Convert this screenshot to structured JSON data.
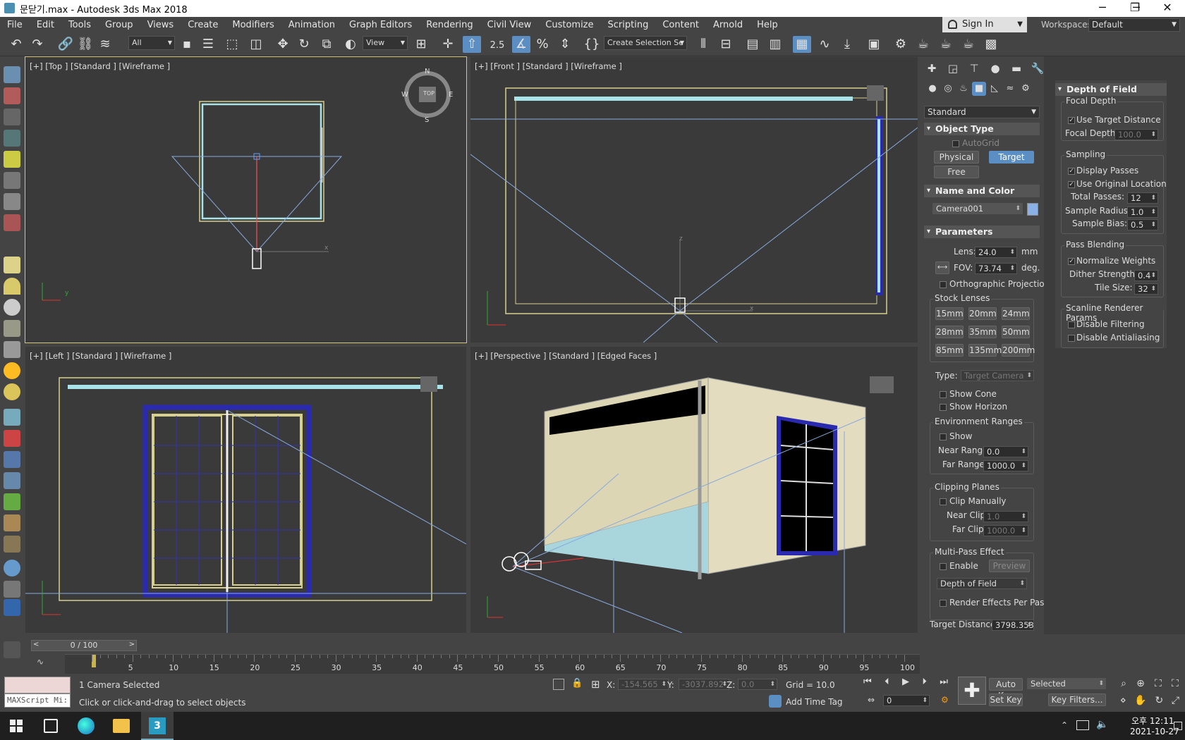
{
  "window": {
    "title": "문닫기.max - Autodesk 3ds Max 2018",
    "min": "─",
    "max": "❐",
    "close": "✕"
  },
  "menu": [
    "File",
    "Edit",
    "Tools",
    "Group",
    "Views",
    "Create",
    "Modifiers",
    "Animation",
    "Graph Editors",
    "Rendering",
    "Civil View",
    "Customize",
    "Scripting",
    "Content",
    "Arnold",
    "Help"
  ],
  "signin": {
    "label": "Sign In"
  },
  "workspaces": {
    "label": "Workspaces:",
    "value": "Default"
  },
  "toolbar": {
    "filter": "All",
    "refcoord": "View",
    "selset": "Create Selection Se",
    "snap_label": "2.5"
  },
  "viewports": {
    "top": "[+] [Top ] [Standard ] [Wireframe ]",
    "front": "[+] [Front ] [Standard ] [Wireframe ]",
    "left": "[+] [Left ] [Standard ] [Wireframe ]",
    "persp": "[+] [Perspective ] [Standard ] [Edged Faces ]",
    "viewcube_top": "TOP",
    "compass": {
      "n": "N",
      "s": "S",
      "e": "E",
      "w": "W"
    },
    "axis": {
      "x": "x",
      "y": "y",
      "z": "z"
    }
  },
  "command_panel": {
    "dropdown": "Standard",
    "object_type": {
      "title": "Object Type",
      "autogrid": "AutoGrid",
      "buttons": [
        "Physical",
        "Target",
        "Free"
      ]
    },
    "name_color": {
      "title": "Name and Color",
      "name": "Camera001",
      "color": "#8ab0e8"
    },
    "parameters": {
      "title": "Parameters",
      "lens_label": "Lens:",
      "lens": "24.0",
      "lens_unit": "mm",
      "fov_label": "FOV:",
      "fov": "73.74",
      "fov_unit": "deg.",
      "ortho": "Orthographic Projection",
      "stock_title": "Stock Lenses",
      "stock": [
        "15mm",
        "20mm",
        "24mm",
        "28mm",
        "35mm",
        "50mm",
        "85mm",
        "135mm",
        "200mm"
      ],
      "type_label": "Type:",
      "type": "Target Camera",
      "show_cone": "Show Cone",
      "show_horizon": "Show Horizon",
      "env_title": "Environment Ranges",
      "env_show": "Show",
      "near_range_label": "Near Range:",
      "near_range": "0.0",
      "far_range_label": "Far Range:",
      "far_range": "1000.0",
      "clip_title": "Clipping Planes",
      "clip_manual": "Clip Manually",
      "near_clip_label": "Near Clip:",
      "near_clip": "1.0",
      "far_clip_label": "Far Clip:",
      "far_clip": "1000.0",
      "mp_title": "Multi-Pass Effect",
      "mp_enable": "Enable",
      "mp_preview": "Preview",
      "mp_effect": "Depth of Field",
      "mp_render": "Render Effects Per Pass",
      "target_dist_label": "Target Distance:",
      "target_dist": "3798.353"
    }
  },
  "dof": {
    "title": "Depth of Field Paramete",
    "focal_title": "Focal Depth",
    "use_target": "Use Target Distance",
    "focal_depth_label": "Focal Depth:",
    "focal_depth": "100.0",
    "sampling_title": "Sampling",
    "display_passes": "Display Passes",
    "use_orig": "Use Original Location",
    "total_passes_label": "Total Passes:",
    "total_passes": "12",
    "sample_radius_label": "Sample Radius:",
    "sample_radius": "1.0",
    "sample_bias_label": "Sample Bias:",
    "sample_bias": "0.5",
    "blend_title": "Pass Blending",
    "normalize": "Normalize Weights",
    "dither_label": "Dither Strength:",
    "dither": "0.4",
    "tile_label": "Tile Size:",
    "tile": "32",
    "scanline_title": "Scanline Renderer Params",
    "disable_filter": "Disable Filtering",
    "disable_aa": "Disable Antialiasing"
  },
  "timeline": {
    "slider": "0 / 100",
    "ticks": [
      "5",
      "10",
      "15",
      "20",
      "25",
      "30",
      "35",
      "40",
      "45",
      "50",
      "55",
      "60",
      "65",
      "70",
      "75",
      "80",
      "85",
      "90",
      "95",
      "100"
    ]
  },
  "status": {
    "maxscript": "MAXScript Mi:",
    "selected": "1 Camera Selected",
    "prompt": "Click or click-and-drag to select objects",
    "x_label": "X:",
    "x": "-154.565",
    "y_label": "Y:",
    "y": "-3037.892",
    "z_label": "Z:",
    "z": "0.0",
    "grid": "Grid = 10.0",
    "add_time_tag": "Add Time Tag",
    "auto_key": "Auto Key",
    "set_key": "Set Key",
    "key_mode": "Selected",
    "frame": "0",
    "key_filters": "Key Filters..."
  },
  "taskbar": {
    "time": "오후 12:11",
    "date": "2021-10-27"
  }
}
